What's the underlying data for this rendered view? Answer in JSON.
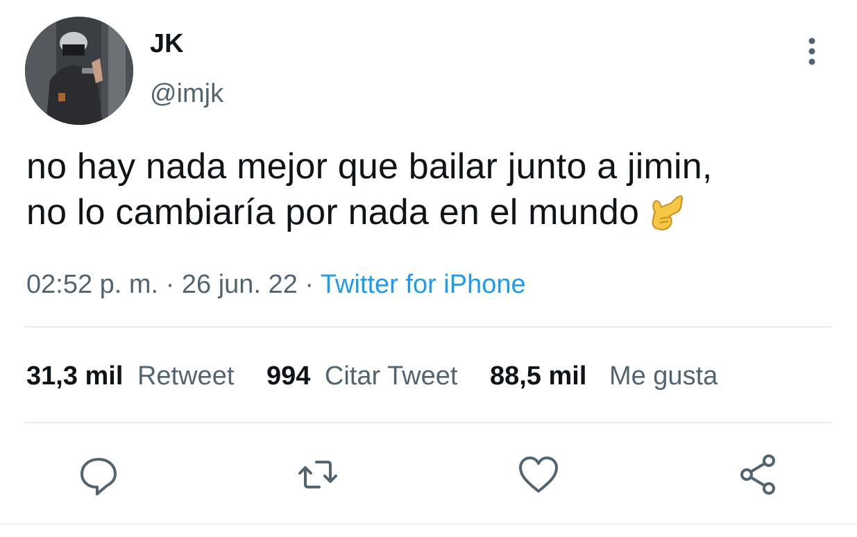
{
  "author": {
    "display_name": "JK",
    "handle": "@imjk",
    "avatar_icon": "user-avatar-photo"
  },
  "tweet": {
    "line1": "no hay nada mejor que bailar junto a jimin,",
    "line2": "no lo cambiaría por nada en el mundo",
    "emoji": "call-me-hand-emoji"
  },
  "meta": {
    "time": "02:52 p. m.",
    "sep1": "·",
    "date": "26 jun. 22",
    "sep2": "·",
    "source": "Twitter for iPhone"
  },
  "stats": {
    "retweets_count": "31,3 mil",
    "retweets_label": "Retweet",
    "quotes_count": "994",
    "quotes_label": "Citar Tweet",
    "likes_count": "88,5 mil",
    "likes_label": "Me gusta"
  },
  "actions": {
    "reply_icon": "reply-icon",
    "retweet_icon": "retweet-icon",
    "like_icon": "heart-icon",
    "share_icon": "share-icon",
    "more_icon": "more-vertical-icon"
  },
  "colors": {
    "text": "#0f1419",
    "secondary": "#536471",
    "link": "#1d9bf0",
    "divider": "#e6e9eb"
  }
}
